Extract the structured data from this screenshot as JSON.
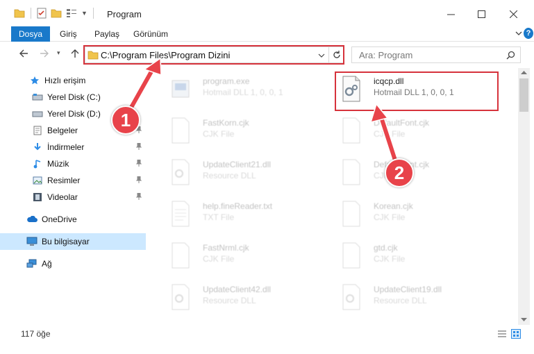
{
  "window": {
    "title": "Program"
  },
  "ribbon": {
    "tabs": [
      "Dosya",
      "Giriş",
      "Paylaş",
      "Görünüm"
    ]
  },
  "address": {
    "path": "C:\\Program Files\\Program Dizini"
  },
  "search": {
    "placeholder": "Ara: Program"
  },
  "sidebar": {
    "items": [
      {
        "label": "Hızlı erişim",
        "icon": "star-icon"
      },
      {
        "label": "Yerel Disk (C:)",
        "icon": "drive-icon"
      },
      {
        "label": "Yerel Disk (D:)",
        "icon": "drive-icon"
      },
      {
        "label": "Belgeler",
        "icon": "documents-icon"
      },
      {
        "label": "İndirmeler",
        "icon": "download-icon"
      },
      {
        "label": "Müzik",
        "icon": "music-icon"
      },
      {
        "label": "Resimler",
        "icon": "pictures-icon"
      },
      {
        "label": "Videolar",
        "icon": "videos-icon"
      },
      {
        "label": "OneDrive",
        "icon": "cloud-icon"
      },
      {
        "label": "Bu bilgisayar",
        "icon": "computer-icon"
      },
      {
        "label": "Ağ",
        "icon": "network-icon"
      }
    ]
  },
  "files": {
    "left": [
      {
        "name": "program.exe",
        "type": "Hotmail DLL 1, 0, 0, 1"
      },
      {
        "name": "FastKorn.cjk",
        "type": "CJK File"
      },
      {
        "name": "UpdateClient21.dll",
        "type": "Resource DLL"
      },
      {
        "name": "help.fineReader.txt",
        "type": "TXT File"
      },
      {
        "name": "FastNrml.cjk",
        "type": "CJK File"
      },
      {
        "name": "UpdateClient42.dll",
        "type": "Resource DLL"
      }
    ],
    "right": [
      {
        "name": "icqcp.dll",
        "type": "Hotmail DLL 1, 0, 0, 1"
      },
      {
        "name": "DefaultFont.cjk",
        "type": "CJK File"
      },
      {
        "name": "DefaultFont.cjk",
        "type": "CJK File"
      },
      {
        "name": "Korean.cjk",
        "type": "CJK File"
      },
      {
        "name": "gtd.cjk",
        "type": "CJK File"
      },
      {
        "name": "UpdateClient19.dll",
        "type": "Resource DLL"
      }
    ]
  },
  "status": {
    "count": "117 öğe"
  },
  "annotations": {
    "step1": "1",
    "step2": "2",
    "color": "#e8434a"
  },
  "colors": {
    "accent": "#1979ca",
    "selection": "#cce8ff",
    "highlight": "#d6323b"
  }
}
